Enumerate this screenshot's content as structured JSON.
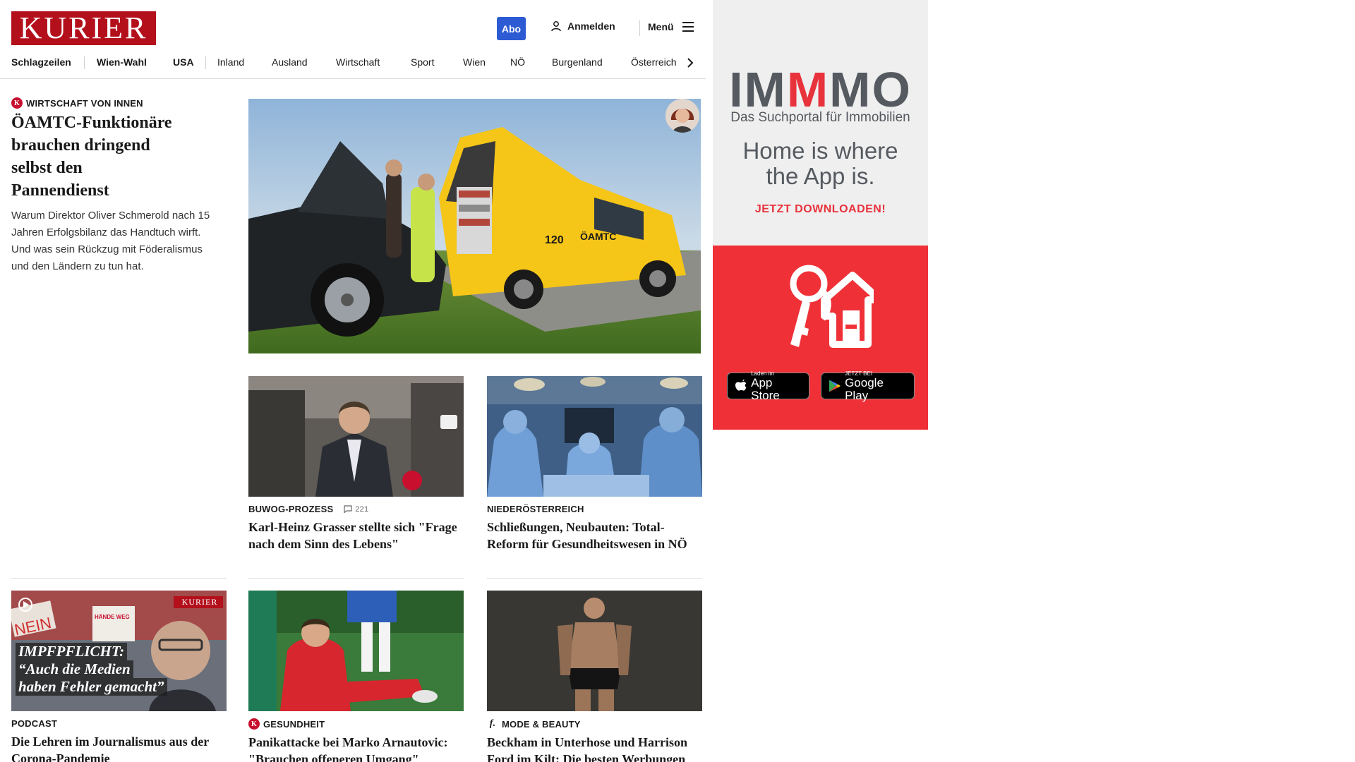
{
  "header": {
    "logo": "KURIER",
    "abo_label": "Abo",
    "login_label": "Anmelden",
    "menu_label": "Menü"
  },
  "nav": {
    "items": [
      "Schlagzeilen",
      "Wien-Wahl",
      "USA",
      "Inland",
      "Ausland",
      "Wirtschaft",
      "Sport",
      "Wien",
      "NÖ",
      "Burgenland",
      "Österreich"
    ]
  },
  "lead": {
    "badge": "K",
    "kicker": "WIRTSCHAFT VON INNEN",
    "headline": "ÖAMTC-Funktionäre brauchen dringend selbst den Pannendienst",
    "teaser": "Warum Direktor Oliver Schmerold nach 15 Jahren Erfolgsbilanz das Handtuch wirft. Und was sein Rückzug mit Föderalismus und den Ländern zu tun hat.",
    "van_text": "ÖAMTC",
    "van_number": "120"
  },
  "cards": [
    {
      "kicker": "BUWOG-PROZESS",
      "comments": "221",
      "headline": "Karl-Heinz Grasser stellte sich \"Frage nach dem Sinn des Lebens\""
    },
    {
      "kicker": "NIEDERÖSTERREICH",
      "headline": "Schließungen, Neubauten: Total-Reform für Gesundheitswesen in NÖ"
    },
    {
      "kicker": "PODCAST",
      "headline": "Die Lehren im Journalismus aus der Corona-Pandemie",
      "overlay_brand": "KURIER",
      "overlay_line1": "IMPFPFLICHT:",
      "overlay_line2": "“Auch die Medien",
      "overlay_line3": "haben Fehler gemacht”",
      "sign_nein": "NEIN",
      "sign_text": "HÄNDE WEG von unseren KINDERN"
    },
    {
      "badge": "K",
      "kicker": "GESUNDHEIT",
      "headline": "Panikattacke bei Marko Arnautovic: \"Brauchen offeneren Umgang\""
    },
    {
      "badge": "f.",
      "kicker": "MODE & BEAUTY",
      "headline": "Beckham in Unterhose und Harrison Ford im Kilt: Die besten Werbungen"
    }
  ],
  "ad": {
    "logo_a": "IM",
    "logo_b": "M",
    "logo_c": "MO",
    "subtitle": "Das Suchportal für Immobilien",
    "claim_1": "Home is where",
    "claim_2": "the App is.",
    "cta": "JETZT DOWNLOADEN!",
    "appstore_small": "Laden im",
    "appstore_big": "App Store",
    "play_small": "JETZT BEI",
    "play_big": "Google Play"
  },
  "colors": {
    "brand_red": "#b3101c",
    "abo_blue": "#2d5bd3",
    "ad_red": "#ef3037",
    "oamtc_yellow": "#f5c518"
  }
}
